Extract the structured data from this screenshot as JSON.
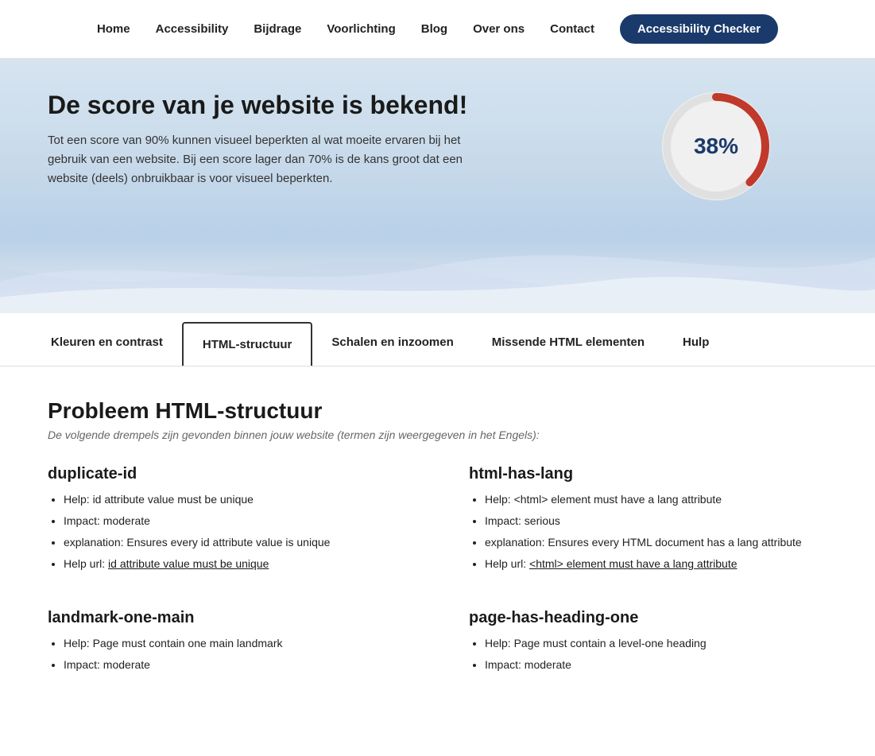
{
  "nav": {
    "links": [
      {
        "id": "home",
        "label": "Home"
      },
      {
        "id": "accessibility",
        "label": "Accessibility"
      },
      {
        "id": "bijdrage",
        "label": "Bijdrage"
      },
      {
        "id": "voorlichting",
        "label": "Voorlichting"
      },
      {
        "id": "blog",
        "label": "Blog"
      },
      {
        "id": "over-ons",
        "label": "Over ons"
      },
      {
        "id": "contact",
        "label": "Contact"
      }
    ],
    "cta_label": "Accessibility Checker"
  },
  "hero": {
    "title": "De score van je website is bekend!",
    "description": "Tot een score van 90% kunnen visueel beperkten al wat moeite ervaren bij het gebruik van een website. Bij een score lager dan 70% is de kans groot dat een website (deels) onbruikbaar is voor visueel beperkten.",
    "score_value": "38%",
    "score_percent": 38
  },
  "tabs": [
    {
      "id": "kleuren",
      "label": "Kleuren en contrast",
      "active": false
    },
    {
      "id": "html-structuur",
      "label": "HTML-structuur",
      "active": true
    },
    {
      "id": "schalen",
      "label": "Schalen en inzoomen",
      "active": false
    },
    {
      "id": "missende",
      "label": "Missende HTML elementen",
      "active": false
    },
    {
      "id": "hulp",
      "label": "Hulp",
      "active": false
    }
  ],
  "content": {
    "section_title": "Probleem HTML-structuur",
    "section_subtitle": "De volgende drempels zijn gevonden binnen jouw website (termen zijn weergegeven in het Engels):",
    "problems": [
      {
        "id": "duplicate-id",
        "title": "duplicate-id",
        "items": [
          {
            "text": "Help: id attribute value must be unique",
            "link": false
          },
          {
            "text": "Impact: moderate",
            "link": false
          },
          {
            "text": "explanation: Ensures every id attribute value is unique",
            "link": false
          },
          {
            "text": "Help url: id attribute value must be unique",
            "link": true,
            "link_text": "id attribute value must be unique"
          }
        ]
      },
      {
        "id": "html-has-lang",
        "title": "html-has-lang",
        "items": [
          {
            "text": "Help: <html> element must have a lang attribute",
            "link": false
          },
          {
            "text": "Impact: serious",
            "link": false
          },
          {
            "text": "explanation: Ensures every HTML document has a lang attribute",
            "link": false
          },
          {
            "text": "Help url: <html> element must have a lang attribute",
            "link": true,
            "link_text": "<html> element must have a lang attribute"
          }
        ]
      },
      {
        "id": "landmark-one-main",
        "title": "landmark-one-main",
        "items": [
          {
            "text": "Help: Page must contain one main landmark",
            "link": false
          },
          {
            "text": "Impact: moderate",
            "link": false
          }
        ]
      },
      {
        "id": "page-has-heading-one",
        "title": "page-has-heading-one",
        "items": [
          {
            "text": "Help: Page must contain a level-one heading",
            "link": false
          },
          {
            "text": "Impact: moderate",
            "link": false
          }
        ]
      }
    ]
  },
  "colors": {
    "accent_blue": "#1a3a6b",
    "score_red": "#c0392b",
    "bg_hero": "#d6e4f0"
  }
}
